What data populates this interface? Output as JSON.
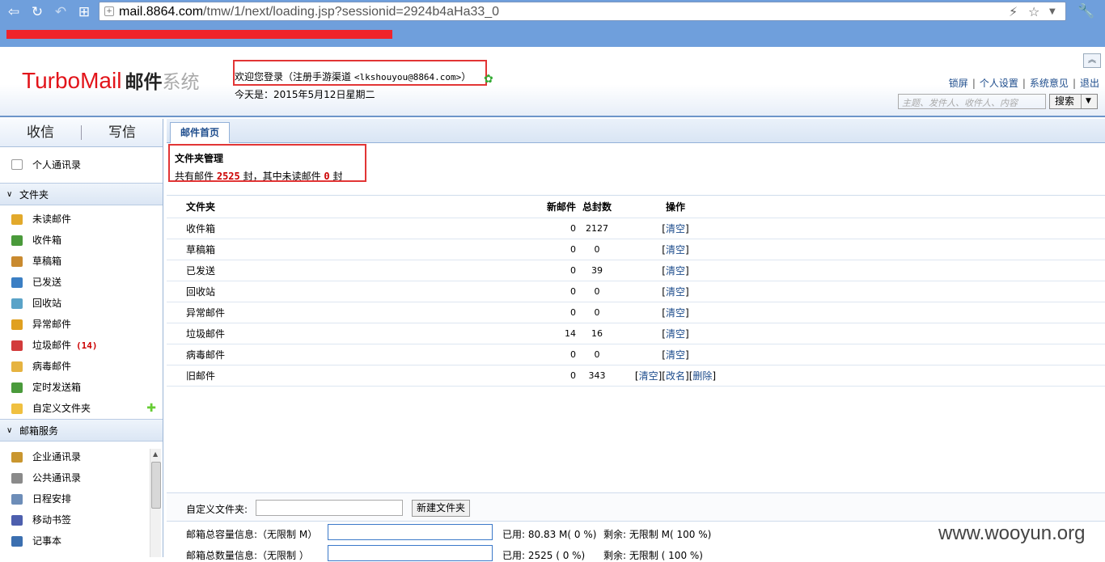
{
  "browser": {
    "url_host": "mail.8864.com",
    "url_path": "/tmw/1/next/loading.jsp?sessionid=2924b4aHa33_0"
  },
  "header": {
    "logo_en": "TurboMail",
    "logo_cn": "邮件",
    "logo_sys": "系统",
    "welcome": "欢迎您登录（注册手游渠道",
    "welcome_email": "<lkshouyou@8864.com>",
    "welcome_close": "）",
    "today": "今天是：2015年5月12日星期二",
    "links": [
      "锁屏",
      "个人设置",
      "系统意见",
      "退出"
    ],
    "search_placeholder": "主题、发件人、收件人、内容",
    "search_button": "搜索"
  },
  "sidebar": {
    "receive": "收信",
    "compose": "写信",
    "contacts": "个人通讯录",
    "folders_section": "文件夹",
    "folders": [
      {
        "label": "未读邮件",
        "color": "#e2a92b"
      },
      {
        "label": "收件箱",
        "color": "#4a9a3b"
      },
      {
        "label": "草稿箱",
        "color": "#c98a2f"
      },
      {
        "label": "已发送",
        "color": "#3b7fc4"
      },
      {
        "label": "回收站",
        "color": "#5aa3c8"
      },
      {
        "label": "异常邮件",
        "color": "#e0a020"
      },
      {
        "label": "垃圾邮件",
        "color": "#d23b3b",
        "count": "(14)"
      },
      {
        "label": "病毒邮件",
        "color": "#e6b340"
      },
      {
        "label": "定时发送箱",
        "color": "#4a9a3b"
      },
      {
        "label": "自定义文件夹",
        "color": "#f0c040"
      }
    ],
    "services_section": "邮箱服务",
    "services": [
      {
        "label": "企业通讯录",
        "color": "#c9962f"
      },
      {
        "label": "公共通讯录",
        "color": "#8a8a8a"
      },
      {
        "label": "日程安排",
        "color": "#6d8db8"
      },
      {
        "label": "移动书签",
        "color": "#4d5fae"
      },
      {
        "label": "记事本",
        "color": "#3b6fb0"
      }
    ]
  },
  "main": {
    "tab": "邮件首页",
    "title": "文件夹管理",
    "summary_prefix": "共有邮件",
    "total": "2525",
    "summary_mid": "封，其中未读邮件",
    "unread": "0",
    "summary_suffix": "封",
    "table_headers": [
      "文件夹",
      "新邮件",
      "总封数",
      "操作"
    ],
    "rows": [
      {
        "name": "收件箱",
        "new": "0",
        "total": "2127"
      },
      {
        "name": "草稿箱",
        "new": "0",
        "total": "0"
      },
      {
        "name": "已发送",
        "new": "0",
        "total": "39"
      },
      {
        "name": "回收站",
        "new": "0",
        "total": "0"
      },
      {
        "name": "异常邮件",
        "new": "0",
        "total": "0"
      },
      {
        "name": "垃圾邮件",
        "new": "14",
        "total": "16"
      },
      {
        "name": "病毒邮件",
        "new": "0",
        "total": "0"
      },
      {
        "name": "旧邮件",
        "new": "0",
        "total": "343"
      }
    ],
    "action_clear": "清空",
    "action_rename": "改名",
    "action_delete": "删除",
    "custom_label": "自定义文件夹:",
    "new_folder_button": "新建文件夹",
    "quota_size_label": "邮箱总容量信息:（无限制 M）",
    "quota_size_used": "已用: 80.83 M( 0 %)",
    "quota_size_rem": "剩余: 无限制 M( 100 %)",
    "quota_count_label": "邮箱总数量信息:（无限制 ）",
    "quota_count_used": "已用: 2525 ( 0 %)",
    "quota_count_rem": "剩余: 无限制 ( 100 %)"
  },
  "watermark": "www.wooyun.org"
}
